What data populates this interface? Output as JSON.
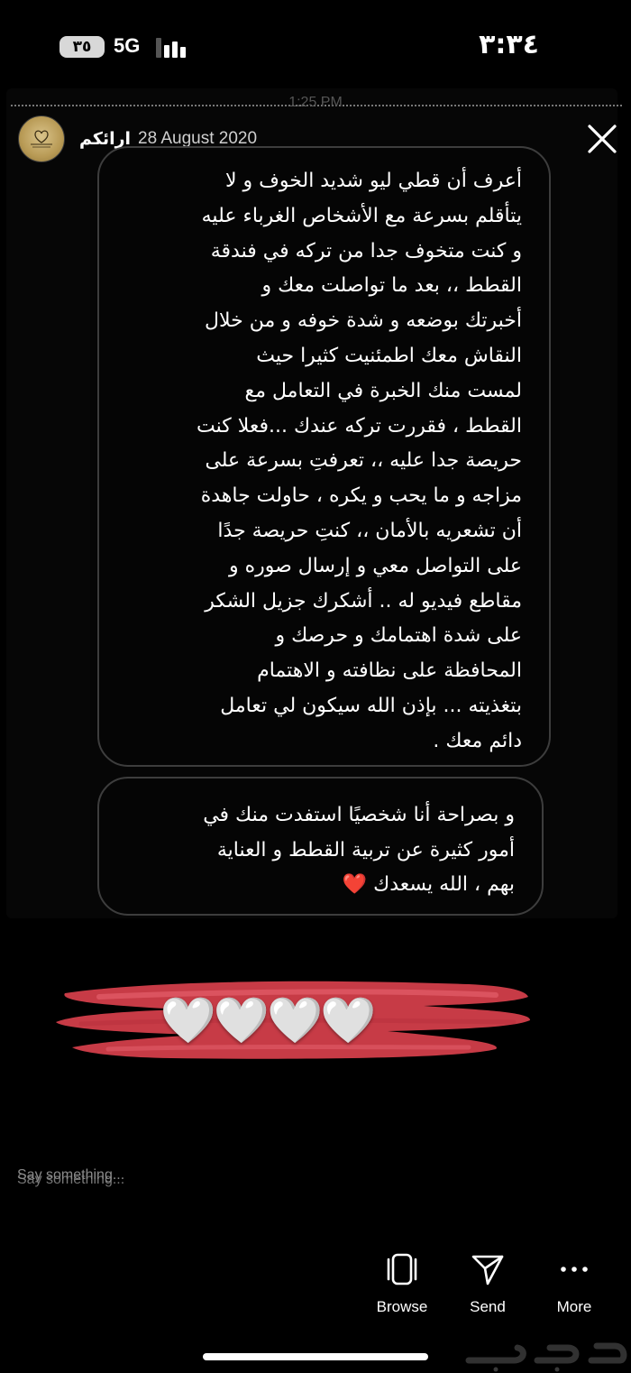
{
  "status_bar": {
    "time": "٣:٣٤",
    "battery": "٣٥",
    "network": "5G"
  },
  "story": {
    "clock": "1:25 PM",
    "username": "ارائكم",
    "date": "28 August 2020",
    "message_1_lines": [
      "أعرف أن قطي ليو شديد الخوف و لا",
      "يتأقلم بسرعة مع الأشخاص الغرباء عليه",
      "و كنت متخوف جدا من تركه في فندقة",
      "القطط ،، بعد ما تواصلت معك و",
      "أخبرتك بوضعه و شدة خوفه و من خلال",
      "النقاش معك اطمئنيت كثيرا حيث",
      "لمست منك الخبرة في التعامل مع",
      "القطط ، فقررت تركه عندك ...فعلا كنت",
      "حريصة جدا عليه ،، تعرفتِ بسرعة على",
      "مزاجه و ما يحب و يكره ، حاولت جاهدة",
      "أن تشعريه بالأمان ،، كنتِ حريصة جدًا",
      "على التواصل معي و إرسال صوره و",
      "مقاطع فيديو له .. أشكرك جزيل الشكر",
      "على شدة اهتمامك و حرصك و",
      "المحافظة على نظافته و الاهتمام",
      "بتغذيته ... بإذن الله سيكون لي تعامل",
      "دائم معك ."
    ],
    "message_2_lines": [
      "و بصراحة أنا شخصيًا استفدت منك في",
      "أمور كثيرة عن تربية القطط و العناية",
      "بهم ، الله يسعدك"
    ],
    "message_2_emoji": "❤️",
    "sticker_hearts": "🤍🤍🤍🤍"
  },
  "reply": {
    "placeholder": "Say something..."
  },
  "actions": {
    "browse": "Browse",
    "send": "Send",
    "more": "More"
  },
  "colors": {
    "background": "#000000",
    "bubble_border": "#3d3d3d",
    "sticker_red": "#d8404c"
  }
}
